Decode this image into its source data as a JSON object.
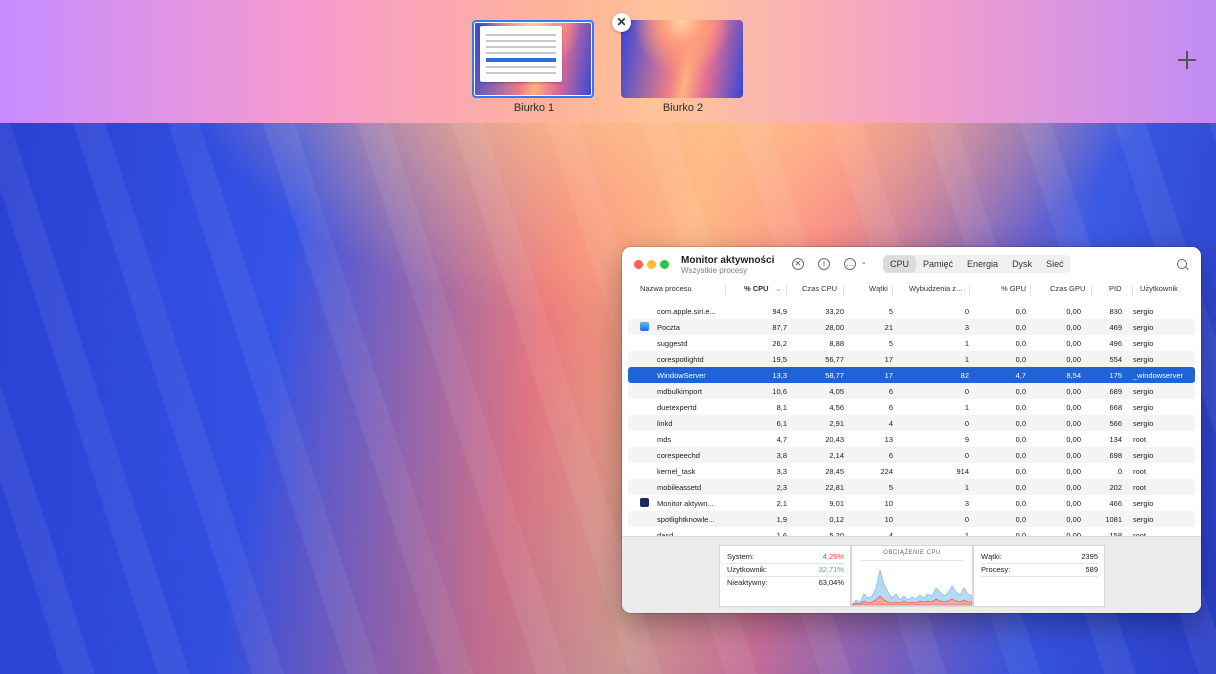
{
  "spaces": {
    "items": [
      {
        "label": "Biurko 1",
        "active": true
      },
      {
        "label": "Biurko 2",
        "active": false
      }
    ],
    "close_glyph": "✕",
    "add_icon": "plus-icon"
  },
  "window": {
    "title": "Monitor aktywności",
    "subtitle": "Wszystkie procesy",
    "toolbar": {
      "stop_glyph": "✕",
      "info_glyph": "i",
      "more_glyph": "…",
      "chevron_glyph": "⌄"
    },
    "tabs": [
      "CPU",
      "Pamięć",
      "Energia",
      "Dysk",
      "Sieć"
    ],
    "selected_tab": "CPU",
    "columns": [
      "Nazwa procesu",
      "% CPU",
      "Czas CPU",
      "Wątki",
      "Wybudzenia z...",
      "% GPU",
      "Czas GPU",
      "PID",
      "Użytkownik"
    ],
    "sort_glyph": "⌄",
    "rows": [
      {
        "name": "com.apple.siri.e...",
        "cpu": "94,9",
        "cpu_time": "33,20",
        "threads": "5",
        "wakeups": "0",
        "gpu": "0,0",
        "gpu_time": "0,00",
        "pid": "830",
        "user": "sergio",
        "icon": ""
      },
      {
        "name": "Poczta",
        "cpu": "87,7",
        "cpu_time": "28,00",
        "threads": "21",
        "wakeups": "3",
        "gpu": "0,0",
        "gpu_time": "0,00",
        "pid": "469",
        "user": "sergio",
        "icon": "mail-icon"
      },
      {
        "name": "suggestd",
        "cpu": "26,2",
        "cpu_time": "8,88",
        "threads": "5",
        "wakeups": "1",
        "gpu": "0,0",
        "gpu_time": "0,00",
        "pid": "496",
        "user": "sergio",
        "icon": ""
      },
      {
        "name": "corespotlightd",
        "cpu": "19,5",
        "cpu_time": "56,77",
        "threads": "17",
        "wakeups": "1",
        "gpu": "0,0",
        "gpu_time": "0,00",
        "pid": "554",
        "user": "sergio",
        "icon": ""
      },
      {
        "name": "WindowServer",
        "cpu": "13,3",
        "cpu_time": "58,77",
        "threads": "17",
        "wakeups": "82",
        "gpu": "4,7",
        "gpu_time": "8,54",
        "pid": "175",
        "user": "_windowserver",
        "icon": "",
        "selected": true
      },
      {
        "name": "mdbulkimport",
        "cpu": "10,6",
        "cpu_time": "4,05",
        "threads": "6",
        "wakeups": "0",
        "gpu": "0,0",
        "gpu_time": "0,00",
        "pid": "689",
        "user": "sergio",
        "icon": ""
      },
      {
        "name": "duetexpertd",
        "cpu": "8,1",
        "cpu_time": "4,56",
        "threads": "6",
        "wakeups": "1",
        "gpu": "0,0",
        "gpu_time": "0,00",
        "pid": "668",
        "user": "sergio",
        "icon": ""
      },
      {
        "name": "linkd",
        "cpu": "6,1",
        "cpu_time": "2,91",
        "threads": "4",
        "wakeups": "0",
        "gpu": "0,0",
        "gpu_time": "0,00",
        "pid": "566",
        "user": "sergio",
        "icon": ""
      },
      {
        "name": "mds",
        "cpu": "4,7",
        "cpu_time": "20,43",
        "threads": "13",
        "wakeups": "9",
        "gpu": "0,0",
        "gpu_time": "0,00",
        "pid": "134",
        "user": "root",
        "icon": ""
      },
      {
        "name": "corespeechd",
        "cpu": "3,8",
        "cpu_time": "2,14",
        "threads": "6",
        "wakeups": "0",
        "gpu": "0,0",
        "gpu_time": "0,00",
        "pid": "698",
        "user": "sergio",
        "icon": ""
      },
      {
        "name": "kernel_task",
        "cpu": "3,3",
        "cpu_time": "28,45",
        "threads": "224",
        "wakeups": "914",
        "gpu": "0,0",
        "gpu_time": "0,00",
        "pid": "0",
        "user": "root",
        "icon": ""
      },
      {
        "name": "mobileassetd",
        "cpu": "2,3",
        "cpu_time": "22,81",
        "threads": "5",
        "wakeups": "1",
        "gpu": "0,0",
        "gpu_time": "0,00",
        "pid": "202",
        "user": "root",
        "icon": ""
      },
      {
        "name": "Monitor aktywn...",
        "cpu": "2,1",
        "cpu_time": "9,01",
        "threads": "10",
        "wakeups": "3",
        "gpu": "0,0",
        "gpu_time": "0,00",
        "pid": "466",
        "user": "sergio",
        "icon": "activity-monitor-icon"
      },
      {
        "name": "spotlightknowle...",
        "cpu": "1,9",
        "cpu_time": "0,12",
        "threads": "10",
        "wakeups": "0",
        "gpu": "0,0",
        "gpu_time": "0,00",
        "pid": "1081",
        "user": "sergio",
        "icon": ""
      },
      {
        "name": "dasd",
        "cpu": "1,6",
        "cpu_time": "5,20",
        "threads": "4",
        "wakeups": "1",
        "gpu": "0,0",
        "gpu_time": "0,00",
        "pid": "158",
        "user": "root",
        "icon": ""
      }
    ],
    "summary": {
      "system_label": "System:",
      "system_value": "4,26%",
      "user_label": "Użytkownik:",
      "user_value": "32,71%",
      "idle_label": "Nieaktywny:",
      "idle_value": "63,04%",
      "load_title": "OBCIĄŻENIE CPU",
      "threads_label": "Wątki:",
      "threads_value": "2395",
      "processes_label": "Procesy:",
      "processes_value": "589",
      "colors": {
        "system": "#e5453a",
        "user": "#4aa3e8"
      }
    }
  }
}
